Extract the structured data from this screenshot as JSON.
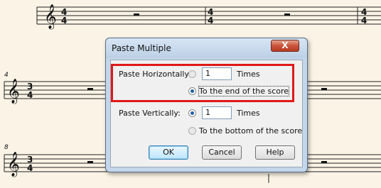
{
  "score": {
    "measure_numbers": [
      "4",
      "8"
    ],
    "time_signature_top_first": "4",
    "time_signature_bottom_first": "4",
    "time_signature_top": "3",
    "time_signature_bottom": "4"
  },
  "dialog": {
    "title": "Paste Multiple",
    "close_glyph": "X",
    "horizontal": {
      "label": "Paste Horizontally:",
      "count": "1",
      "times_label": "Times",
      "to_end_label": "To the end of the score"
    },
    "vertical": {
      "label": "Paste Vertically:",
      "count": "1",
      "times_label": "Times",
      "to_bottom_label": "To the bottom of the score"
    },
    "buttons": {
      "ok": "OK",
      "cancel": "Cancel",
      "help": "Help"
    }
  },
  "colors": {
    "highlight": "#e01818",
    "paper": "#fbf4e6"
  }
}
